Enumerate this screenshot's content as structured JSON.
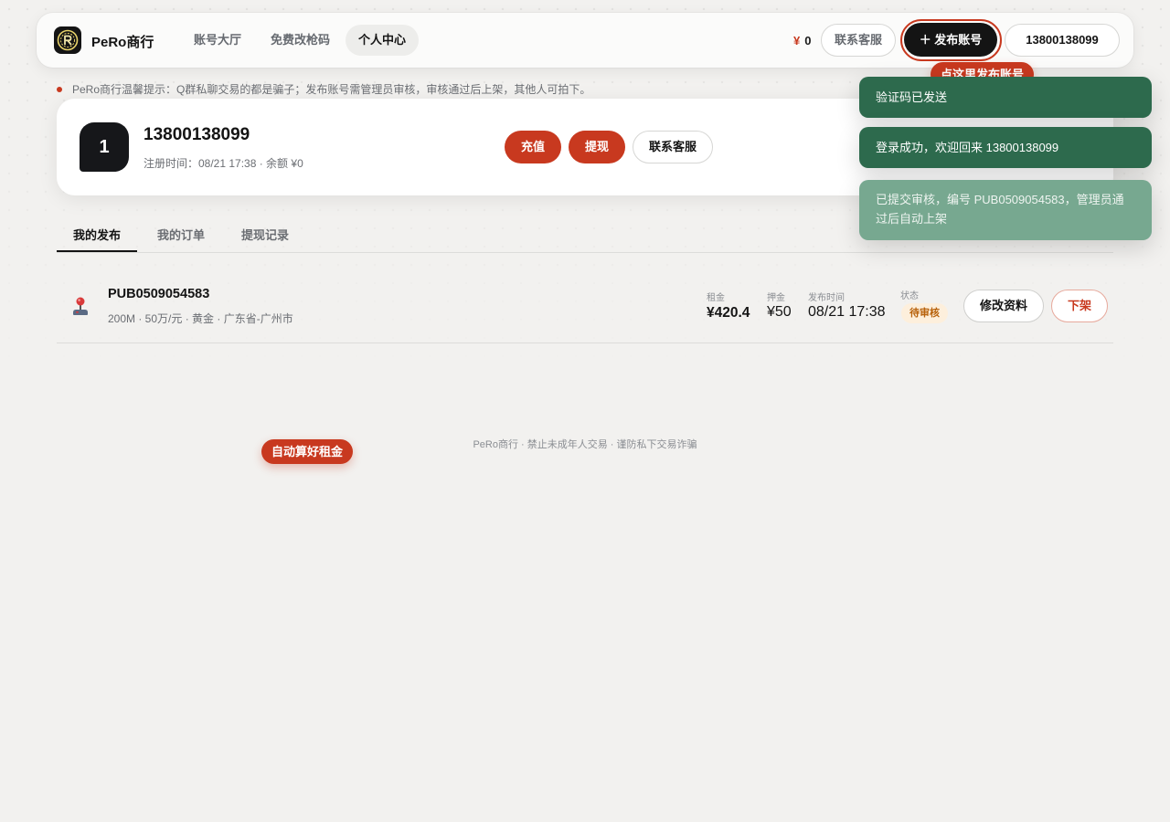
{
  "brand": {
    "name": "PeRo商行",
    "logo_icon": "pero-logo-icon"
  },
  "nav": {
    "items": [
      {
        "label": "账号大厅",
        "active": false
      },
      {
        "label": "免费改枪码",
        "active": false
      },
      {
        "label": "个人中心",
        "active": true
      }
    ]
  },
  "header": {
    "currency_symbol": "¥",
    "balance": "0",
    "support_label": "联系客服",
    "publish_label": "＋ 发布账号",
    "user_label": "13800138099"
  },
  "tips": {
    "publish_hint": "点这里发布账号",
    "rent_hint": "自动算好租金"
  },
  "notice": "PeRo商行温馨提示：Q群私聊交易的都是骗子；发布账号需管理员审核，审核通过后上架，其他人可拍下。",
  "profile": {
    "avatar_text": "1",
    "name": "13800138099",
    "meta": "注册时间：08/21 17:38 · 余额 ¥0",
    "recharge_label": "充值",
    "withdraw_label": "提现",
    "support_label": "联系客服"
  },
  "tabs": [
    {
      "label": "我的发布",
      "active": true
    },
    {
      "label": "我的订单",
      "active": false
    },
    {
      "label": "提现记录",
      "active": false
    }
  ],
  "listing": {
    "icon": "joystick-icon",
    "id": "PUB0509054583",
    "subtitle": "200M · 50万/元 · 黄金 · 广东省-广州市",
    "rent_label": "租金",
    "rent_value": "¥420.4",
    "deposit_label": "押金",
    "deposit_value": "¥50",
    "time_label": "发布时间",
    "time_value": "08/21 17:38",
    "status_label": "状态",
    "status_value": "待审核",
    "edit_label": "修改资料",
    "delist_label": "下架"
  },
  "footer": "PeRo商行 · 禁止未成年人交易 · 谨防私下交易诈骗",
  "toasts": [
    "验证码已发送",
    "登录成功，欢迎回来 13800138099",
    "已提交审核，编号 PUB0509054583，管理员通过后自动上架"
  ],
  "colors": {
    "accent": "#c8391f",
    "dark": "#141414",
    "toast": "#2d6a4d",
    "pending_bg": "#fdefdc",
    "pending_text": "#b8620c"
  }
}
